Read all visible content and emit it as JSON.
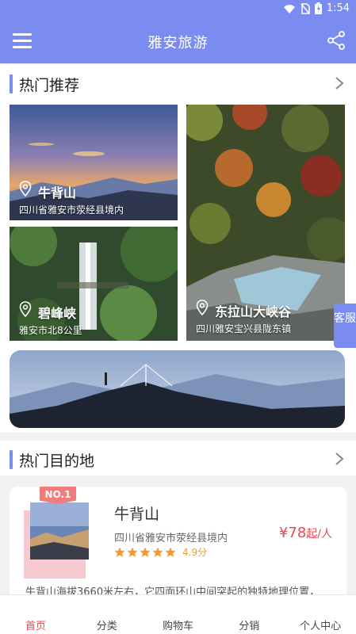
{
  "status": {
    "time": "1:54"
  },
  "header": {
    "title": "雅安旅游"
  },
  "hot_recommend": {
    "title": "热门推荐",
    "items": [
      {
        "name": "牛背山",
        "addr": "四川省雅安市荥经县境内"
      },
      {
        "name": "碧峰峡",
        "addr": "雅安市北8公里"
      },
      {
        "name": "东拉山大峡谷",
        "addr": "四川雅安宝兴县陇东镇"
      }
    ]
  },
  "customer_service": "客服",
  "hot_destination": {
    "title": "热门目的地",
    "item": {
      "badge": "NO.1",
      "name": "牛背山",
      "addr": "四川省雅安市荥经县境内",
      "price": "¥78",
      "price_unit": "起/人",
      "rating": 4.9,
      "score_text": "4.9分",
      "desc": "牛背山海拔3660米左右，它四面环山中间突起的独特地理位置，"
    }
  },
  "tabs": [
    "首页",
    "分类",
    "购物车",
    "分销",
    "个人中心"
  ],
  "colors": {
    "primary": "#7b8cf0",
    "accent": "#f0464c",
    "star": "#f29a2e"
  }
}
